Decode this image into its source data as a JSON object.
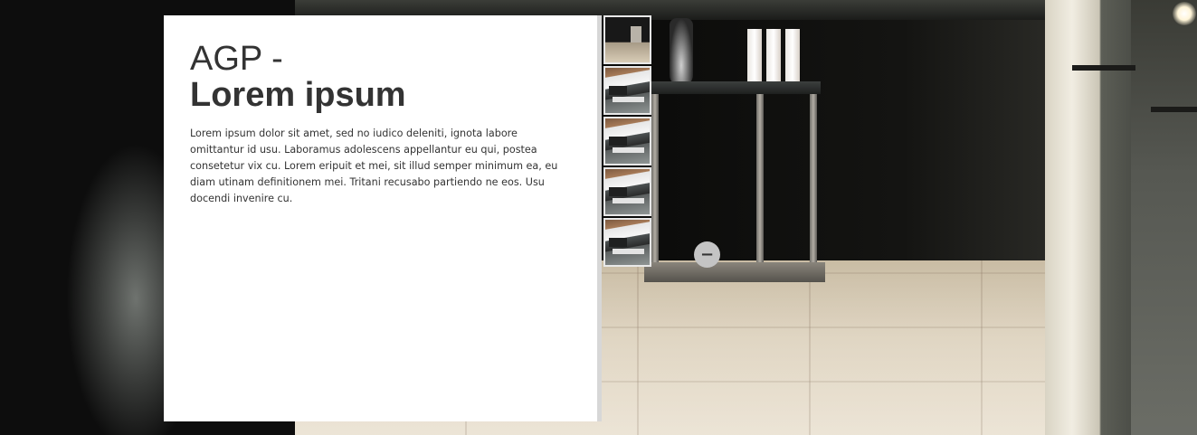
{
  "panel": {
    "title_line1": "AGP -",
    "title_line2": "Lorem ipsum",
    "body": "Lorem ipsum dolor sit amet, sed no iudico deleniti, ignota labore omittantur id usu. Laboramus adolescens appellantur eu qui, postea consetetur vix cu. Lorem eripuit et mei, sit illud semper minimum ea, eu diam utinam definitionem mei. Tritani recusabo partiendo ne eos. Usu docendi invenire cu."
  },
  "thumbnails": {
    "count": 5,
    "items": [
      "thumbnail-console-scene",
      "thumbnail-interior",
      "thumbnail-interior",
      "thumbnail-interior",
      "thumbnail-interior"
    ]
  },
  "collapse_button": {
    "icon": "minus-icon",
    "glyph": "−"
  },
  "colors": {
    "panel_bg": "#ffffff",
    "text": "#333333",
    "button_bg": "#c4c4c4"
  }
}
